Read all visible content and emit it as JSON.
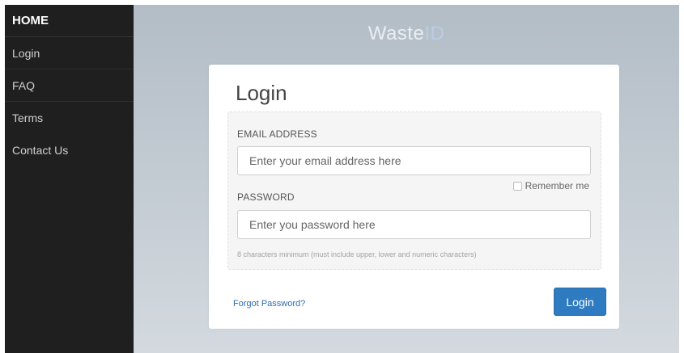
{
  "sidebar": {
    "items": [
      {
        "label": "HOME"
      },
      {
        "label": "Login"
      },
      {
        "label": "FAQ"
      },
      {
        "label": "Terms"
      },
      {
        "label": "Contact Us"
      }
    ]
  },
  "brand": {
    "prefix": "Waste",
    "suffix": "ID"
  },
  "login": {
    "title": "Login",
    "email_label": "EMAIL ADDRESS",
    "email_placeholder": "Enter your email address here",
    "remember_label": "Remember me",
    "password_label": "PASSWORD",
    "password_placeholder": "Enter you password here",
    "password_hint": "8 characters minimum (must include upper, lower and numeric characters)",
    "forgot_label": "Forgot Password?",
    "submit_label": "Login"
  },
  "colors": {
    "sidebar_bg": "#1f1f1f",
    "primary_button": "#2f7bc1",
    "link": "#2f6bb5"
  }
}
